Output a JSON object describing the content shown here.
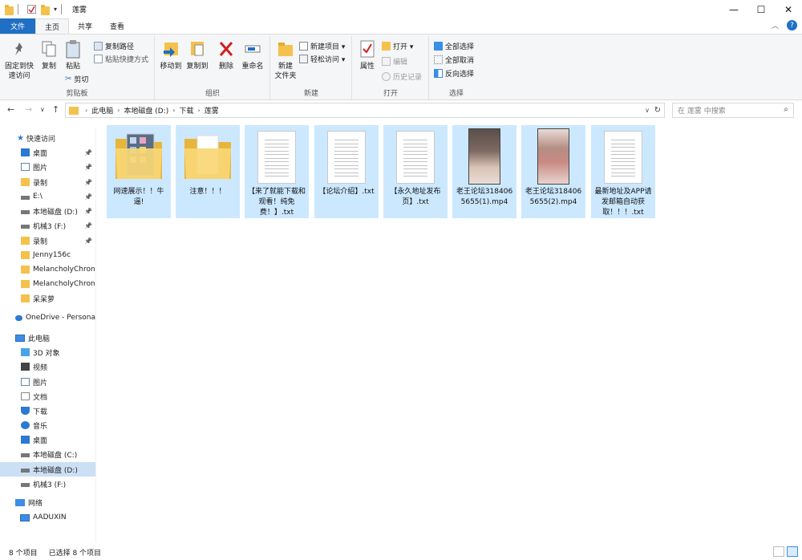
{
  "window": {
    "title": "莲雾",
    "minimize": "—",
    "maximize": "☐",
    "close": "✕"
  },
  "ribbon_tabs": [
    "文件",
    "主页",
    "共享",
    "查看"
  ],
  "ribbon": {
    "clipboard": {
      "label": "剪贴板",
      "pin_quick": [
        "固定到快",
        "速访问"
      ],
      "copy": "复制",
      "paste": "粘贴",
      "copy_path": "复制路径",
      "paste_shortcut": "粘贴快捷方式",
      "cut": "剪切"
    },
    "organize": {
      "label": "组织",
      "move_to": "移动到",
      "copy_to": "复制到",
      "delete": "删除",
      "rename": "重命名"
    },
    "new": {
      "label": "新建",
      "new_folder": [
        "新建",
        "文件夹"
      ],
      "new_item": "新建项目 ▾",
      "easy_access": "轻松访问 ▾"
    },
    "open": {
      "label": "打开",
      "properties": "属性",
      "open": "打开 ▾",
      "edit": "编辑",
      "history": "历史记录"
    },
    "select": {
      "label": "选择",
      "select_all": "全部选择",
      "select_none": "全部取消",
      "invert": "反向选择"
    }
  },
  "address": {
    "crumbs": [
      "此电脑",
      "本地磁盘 (D:)",
      "下载",
      "莲雾"
    ],
    "search_placeholder": "在 莲雾 中搜索"
  },
  "navpane": {
    "quick_access": "快速访问",
    "quick_items": [
      {
        "label": "桌面",
        "pinned": true,
        "icon": "desktop-icon"
      },
      {
        "label": "图片",
        "pinned": true,
        "icon": "pictures-icon"
      },
      {
        "label": "录制",
        "pinned": true,
        "icon": "folder-icon"
      },
      {
        "label": "E:\\",
        "pinned": true,
        "icon": "drive-icon"
      },
      {
        "label": "本地磁盘 (D:)",
        "pinned": true,
        "icon": "drive-icon"
      },
      {
        "label": "机械3 (F:)",
        "pinned": true,
        "icon": "drive-icon"
      },
      {
        "label": "录制",
        "pinned": true,
        "icon": "folder-icon"
      },
      {
        "label": "Jenny156c",
        "pinned": false,
        "icon": "folder-icon"
      },
      {
        "label": "MelancholyChroni",
        "pinned": false,
        "icon": "folder-icon"
      },
      {
        "label": "MelancholyChroni",
        "pinned": false,
        "icon": "folder-icon"
      },
      {
        "label": "呆呆萝",
        "pinned": false,
        "icon": "folder-icon"
      }
    ],
    "onedrive": "OneDrive - Persona",
    "this_pc": "此电脑",
    "pc_items": [
      {
        "label": "3D 对象",
        "icon": "3d-objects-icon",
        "selected": false
      },
      {
        "label": "视频",
        "icon": "videos-icon",
        "selected": false
      },
      {
        "label": "图片",
        "icon": "pictures-icon",
        "selected": false
      },
      {
        "label": "文档",
        "icon": "documents-icon",
        "selected": false
      },
      {
        "label": "下载",
        "icon": "downloads-icon",
        "selected": false
      },
      {
        "label": "音乐",
        "icon": "music-icon",
        "selected": false
      },
      {
        "label": "桌面",
        "icon": "desktop-icon",
        "selected": false
      },
      {
        "label": "本地磁盘 (C:)",
        "icon": "drive-icon",
        "selected": false
      },
      {
        "label": "本地磁盘 (D:)",
        "icon": "drive-icon",
        "selected": true
      },
      {
        "label": "机械3 (F:)",
        "icon": "drive-icon",
        "selected": false
      }
    ],
    "network": "网络",
    "network_items": [
      {
        "label": "AADUXIN",
        "icon": "computer-icon"
      }
    ]
  },
  "files": [
    {
      "name": "网速展示！！牛逼!",
      "type": "folder-preview"
    },
    {
      "name": "注意！！！",
      "type": "folder"
    },
    {
      "name": "【来了就能下载和观看！纯免费！】.txt",
      "type": "txt"
    },
    {
      "name": "【论坛介绍】.txt",
      "type": "txt"
    },
    {
      "name": "【永久地址发布页】.txt",
      "type": "txt"
    },
    {
      "name": "老王论坛3184065655(1).mp4",
      "type": "video"
    },
    {
      "name": "老王论坛3184065655(2).mp4",
      "type": "video"
    },
    {
      "name": "最新地址及APP请发邮箱自动获取！！！.txt",
      "type": "txt"
    }
  ],
  "status": {
    "count": "8 个项目",
    "selected": "已选择 8 个项目"
  },
  "colors": {
    "accent": "#1f6fc4",
    "selection": "#cce8ff",
    "folder": "#f4c24c"
  }
}
